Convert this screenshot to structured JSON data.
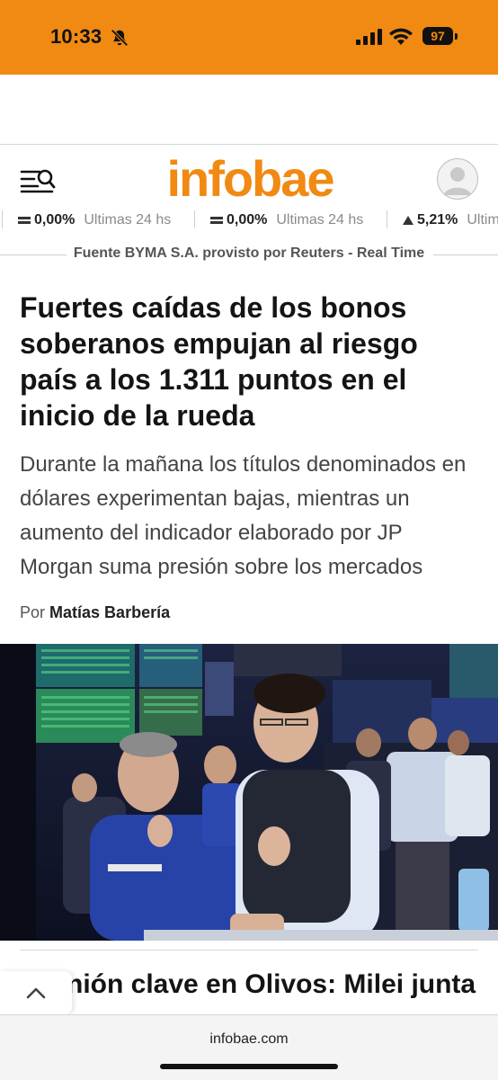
{
  "status_bar": {
    "time": "10:33",
    "battery": "97",
    "background_color": "#f08a13"
  },
  "header": {
    "logo_text": "infobae",
    "brand_color": "#f08a13",
    "menu_icon": "menu-search-icon",
    "avatar_icon": "user-avatar-icon"
  },
  "ticker": {
    "items": [
      {
        "icon": "equal-icon",
        "value": "0,00%",
        "period": "Ultimas 24 hs"
      },
      {
        "icon": "equal-icon",
        "value": "0,00%",
        "period": "Ultimas 24 hs"
      },
      {
        "icon": "triangle-up-icon",
        "value": "5,21%",
        "period": "Ultim"
      }
    ],
    "source": "Fuente BYMA S.A. provisto por Reuters - Real Time"
  },
  "article": {
    "headline": "Fuertes caídas de los bonos soberanos empujan al riesgo país a los 1.311 puntos en el inicio de la rueda",
    "dek": "Durante la mañana los títulos denominados en dólares experimentan bajas, mientras un aumento del indicador elaborado por JP Morgan suma presión sobre los mercados",
    "byline_prefix": "Por",
    "author": "Matías Barbería"
  },
  "next_article": {
    "headline_visible": "nión clave en Olivos: Milei junta"
  },
  "browser": {
    "url": "infobae.com"
  }
}
